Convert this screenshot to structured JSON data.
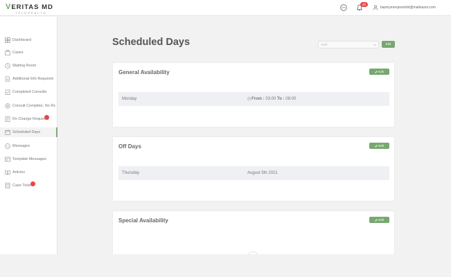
{
  "brand": {
    "name": "VERITAS MD",
    "tagline": "TELEHEALTH"
  },
  "header": {
    "notification_count": "20",
    "user_email": "basmymenpresmbt@mailnasor.com"
  },
  "sidebar": {
    "items": [
      {
        "label": "Dashboard",
        "icon": "dashboard-icon"
      },
      {
        "label": "Cases",
        "icon": "cases-icon"
      },
      {
        "label": "Waiting Room",
        "icon": "waiting-room-icon"
      },
      {
        "label": "Additional Info Required",
        "icon": "document-icon"
      },
      {
        "label": "Completed Consults",
        "icon": "clipboard-icon"
      },
      {
        "label": "Consult Complete, No Rx",
        "icon": "settings-icon"
      },
      {
        "label": "Rx Change Requests",
        "icon": "rx-icon",
        "badge": true
      },
      {
        "label": "Scheduled Days",
        "icon": "calendar-icon",
        "active": true
      },
      {
        "label": "Messages",
        "icon": "message-icon"
      },
      {
        "label": "Template Messages",
        "icon": "template-icon"
      },
      {
        "label": "Articles",
        "icon": "articles-icon"
      },
      {
        "label": "Case Tickets",
        "icon": "ticket-icon",
        "badge": true
      }
    ]
  },
  "main": {
    "title": "Scheduled Days",
    "select_placeholder": "Staff",
    "top_edit_label": "Edit",
    "cards": [
      {
        "title": "General Availability",
        "edit_label": "Edit",
        "rows": [
          {
            "day": "Monday",
            "from_label": "From :",
            "from_value": "03:00",
            "to_label": "To :",
            "to_value": "08:00"
          }
        ]
      },
      {
        "title": "Off Days",
        "edit_label": "Edit",
        "rows": [
          {
            "day": "Thursday",
            "date": "August 5th 2021"
          }
        ]
      },
      {
        "title": "Special Availability",
        "edit_label": "Edit",
        "rows": []
      }
    ]
  },
  "colors": {
    "accent": "#77a86f",
    "badge": "#e8474a",
    "background": "#f2f2f2"
  }
}
